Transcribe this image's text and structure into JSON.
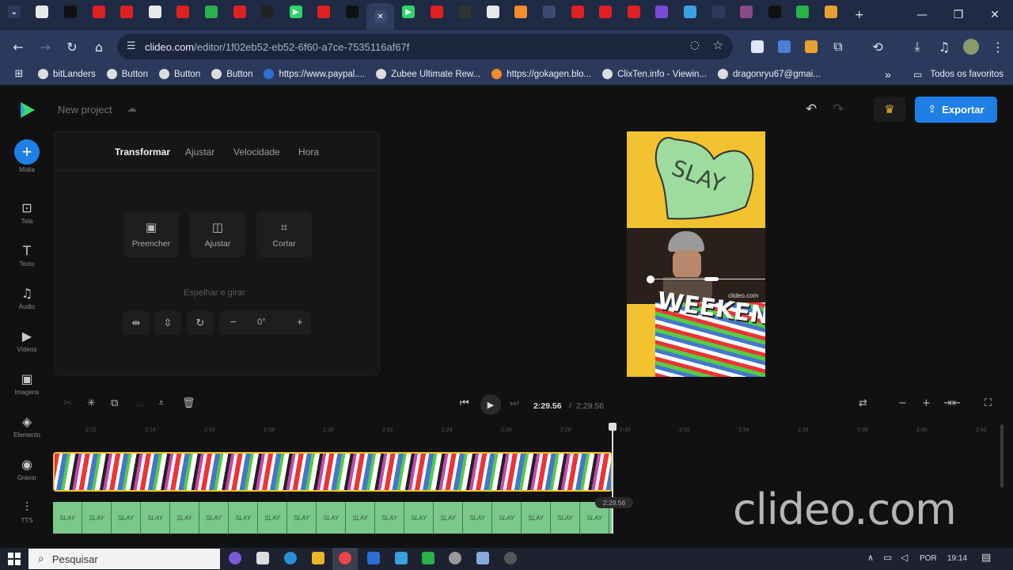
{
  "browser": {
    "tabs": [
      {
        "icon": "menu-icon",
        "color": "#2b3a5c"
      },
      {
        "icon": "chrome-icon",
        "color": "#e8e8e8"
      },
      {
        "icon": "tab-icon",
        "color": "#111111"
      },
      {
        "icon": "youtube-icon",
        "color": "#e02020"
      },
      {
        "icon": "youtube-icon",
        "color": "#e02020"
      },
      {
        "icon": "tab-icon",
        "color": "#e8e8e8"
      },
      {
        "icon": "youtube-icon",
        "color": "#e02020"
      },
      {
        "icon": "tab-icon",
        "color": "#2ab24a"
      },
      {
        "icon": "youtube-icon",
        "color": "#e02020"
      },
      {
        "icon": "tab-icon",
        "color": "#222222"
      },
      {
        "icon": "play-icon",
        "color": "#2bd56b"
      },
      {
        "icon": "tab-icon",
        "color": "#e02020"
      },
      {
        "icon": "tiktok-icon",
        "color": "#111111"
      },
      {
        "icon": "close-icon",
        "color": "#3a4a70"
      },
      {
        "icon": "play-icon",
        "color": "#2bd56b"
      },
      {
        "icon": "tab-icon",
        "color": "#e02020"
      },
      {
        "icon": "tab-icon",
        "color": "#333333"
      },
      {
        "icon": "tab-icon",
        "color": "#e8e8e8"
      },
      {
        "icon": "tab-icon",
        "color": "#f48c2a"
      },
      {
        "icon": "cloud-icon",
        "color": "#3a4a70"
      },
      {
        "icon": "youtube-icon",
        "color": "#e02020"
      },
      {
        "icon": "youtube-icon",
        "color": "#e02020"
      },
      {
        "icon": "youtube-icon",
        "color": "#e02020"
      },
      {
        "icon": "tab-icon",
        "color": "#7a4ad6"
      },
      {
        "icon": "tab-icon",
        "color": "#3aa0e0"
      },
      {
        "icon": "tab-icon",
        "color": "#2b3a5c"
      },
      {
        "icon": "tab-icon",
        "color": "#8a4a8a"
      },
      {
        "icon": "tab-icon",
        "color": "#111111"
      },
      {
        "icon": "tab-icon",
        "color": "#2ab24a"
      },
      {
        "icon": "tab-icon",
        "color": "#e8a030"
      }
    ],
    "new_tab": "+",
    "url_host": "clideo.com",
    "url_path": "/editor/1f02eb52-eb52-6f60-a7ce-7535116af67f",
    "bookmarks": [
      {
        "label": "bitLanders",
        "icon": "bitlanders-icon",
        "color": "#dddddd"
      },
      {
        "label": "Button",
        "icon": "chrome-icon",
        "color": "#dddddd"
      },
      {
        "label": "Button",
        "icon": "chrome-icon",
        "color": "#dddddd"
      },
      {
        "label": "Button",
        "icon": "chrome-icon",
        "color": "#dddddd"
      },
      {
        "label": "https://www.paypal....",
        "icon": "paypal-icon",
        "color": "#2b6fd6"
      },
      {
        "label": "Zubee Ultimate Rew...",
        "icon": "chrome-icon",
        "color": "#dddddd"
      },
      {
        "label": "https://gokagen.blo...",
        "icon": "blogger-icon",
        "color": "#f48c2a"
      },
      {
        "label": "ClixTen.info - Viewin...",
        "icon": "chrome-icon",
        "color": "#dddddd"
      },
      {
        "label": "dragonryu67@gmai...",
        "icon": "google-icon",
        "color": "#dddddd"
      }
    ],
    "bookmarks_overflow": "»",
    "all_bookmarks": "Todos os favoritos"
  },
  "editor": {
    "project_name": "New project",
    "export_label": "Exportar",
    "sidebar": [
      {
        "label": "Mídia",
        "icon": "plus-icon"
      },
      {
        "label": "Tela",
        "icon": "canvas-icon"
      },
      {
        "label": "Texto",
        "icon": "text-icon"
      },
      {
        "label": "Áudio",
        "icon": "music-icon"
      },
      {
        "label": "Vídeos",
        "icon": "video-icon"
      },
      {
        "label": "Imagens",
        "icon": "image-icon"
      },
      {
        "label": "Elemento",
        "icon": "element-icon"
      },
      {
        "label": "Gravar",
        "icon": "record-icon"
      },
      {
        "label": "TTS",
        "icon": "tts-icon"
      }
    ],
    "panel": {
      "tabs": [
        "Transformar",
        "Ajustar",
        "Velocidade",
        "Hora"
      ],
      "options": [
        "Preencher",
        "Ajustar",
        "Cortar"
      ],
      "mirror_label": "Espelhar e girar",
      "rotation": "0°"
    },
    "preview": {
      "candy_text": "SLAY",
      "watermark_small": "clideo.com",
      "title_text": "WEEKEND"
    },
    "timeline": {
      "current_time": "2:29.56",
      "separator": "/",
      "total_time": "2:29.56",
      "ticks": [
        "2:12",
        "2:14",
        "2:16",
        "2:18",
        "2:20",
        "2:22",
        "2:24",
        "2:26",
        "2:28",
        "2:30",
        "2:32",
        "2:34",
        "2:36",
        "2:38",
        "2:40",
        "2:42"
      ],
      "playhead_time": "2:29.56",
      "heart_label": "SLAY"
    },
    "watermark": "clideo.com"
  },
  "taskbar": {
    "search_placeholder": "Pesquisar",
    "language": "POR",
    "clock": "19:14"
  }
}
